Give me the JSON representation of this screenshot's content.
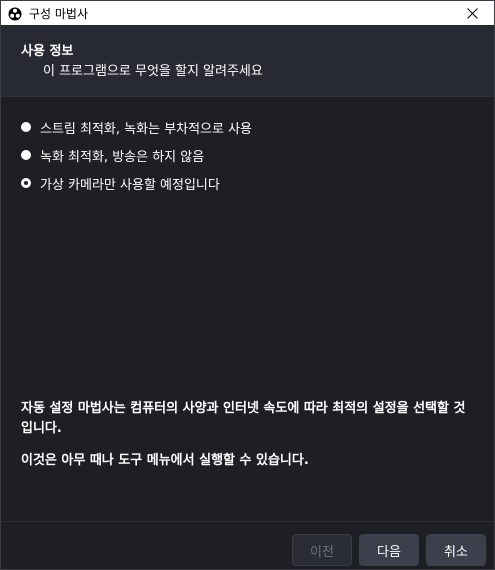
{
  "window": {
    "title": "구성 마법사",
    "close_icon": "close-icon",
    "app_icon": "obs-icon"
  },
  "header": {
    "title": "사용 정보",
    "subtitle": "이 프로그램으로 무엇을 할지 알려주세요"
  },
  "options": [
    {
      "label": "스트림 최적화, 녹화는 부차적으로 사용",
      "selected": false
    },
    {
      "label": "녹화 최적화, 방송은 하지 않음",
      "selected": false
    },
    {
      "label": "가상 카메라만 사용할 예정입니다",
      "selected": true
    }
  ],
  "info": {
    "line1": "자동 설정 마법사는 컴퓨터의 사양과 인터넷 속도에 따라 최적의 설정을 선택할 것입니다.",
    "line2": "이것은 아무 때나 도구 메뉴에서 실행할 수 있습니다."
  },
  "buttons": {
    "back": "이전",
    "next": "다음",
    "cancel": "취소"
  }
}
